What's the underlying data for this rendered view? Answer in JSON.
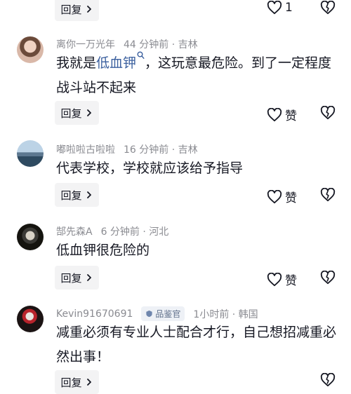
{
  "reply_label": "回复",
  "comments": [
    {
      "like_label": "1"
    },
    {
      "username": "离你一万光年",
      "time": "44 分钟前 · 吉林",
      "text_before": "我就是",
      "link_text": "低血钾",
      "text_after": "，这玩意最危险。到了一定程度战斗站不起来",
      "like_label": "赞"
    },
    {
      "username": "嘟啦啦古啦啦",
      "time": "16 分钟前 · 吉林",
      "text": "代表学校，学校就应该给予指导",
      "like_label": "赞"
    },
    {
      "username": "郜先森A",
      "time": "6 分钟前 · 河北",
      "text": "低血钾很危险的",
      "like_label": "赞"
    },
    {
      "username": "Kevin91670691",
      "badge": "品鉴官",
      "time": "1小时前 · 韩国",
      "text": "减重必须有专业人士配合才行，自己想招减重必然出事！"
    }
  ],
  "colors": {
    "link": "#3a5f9e",
    "meta": "#8a8b91",
    "reply_bg": "#f3f3f4",
    "badge_bg": "#eef1f6"
  }
}
